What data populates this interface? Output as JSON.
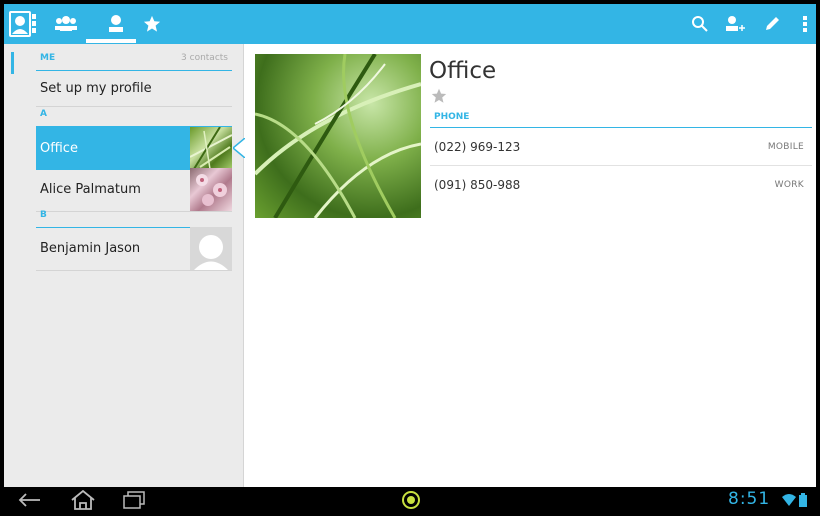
{
  "actionbar": {
    "tabs": [
      {
        "name": "groups",
        "icon": "groups-icon"
      },
      {
        "name": "all-contacts",
        "icon": "person-icon",
        "selected": true
      },
      {
        "name": "favorites",
        "icon": "star-icon"
      }
    ],
    "actions": [
      "search-icon",
      "add-contact-icon",
      "edit-icon",
      "overflow-menu-icon"
    ],
    "accent": "#33b5e5"
  },
  "sidebar": {
    "me_header": "ME",
    "count": "3 contacts",
    "profile_label": "Set up my profile",
    "sections": [
      {
        "letter": "A",
        "contacts": [
          {
            "name": "Office",
            "selected": true
          },
          {
            "name": "Alice Palmatum"
          }
        ]
      },
      {
        "letter": "B",
        "contacts": [
          {
            "name": "Benjamin Jason"
          }
        ]
      }
    ]
  },
  "detail": {
    "name": "Office",
    "phone_header": "PHONE",
    "phones": [
      {
        "number": "(022) 969-123",
        "type": "MOBILE"
      },
      {
        "number": "(091) 850-988",
        "type": "WORK"
      }
    ]
  },
  "sysbar": {
    "time": "8:51"
  }
}
